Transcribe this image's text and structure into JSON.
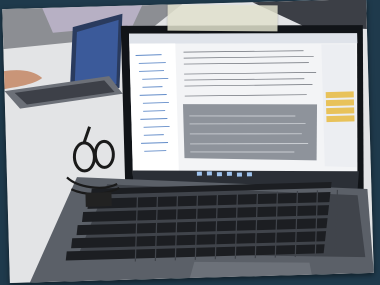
{
  "photo": {
    "subject": "",
    "colors": {
      "background": "#1f3a4c",
      "desk": "#e6e7e8",
      "laptop_body": "#5b6068",
      "keyboard_keys": "#1c1e22",
      "screen_bezel": "#111418",
      "taskbar": "#2b2f36",
      "highlight": "#e8c25a"
    }
  }
}
